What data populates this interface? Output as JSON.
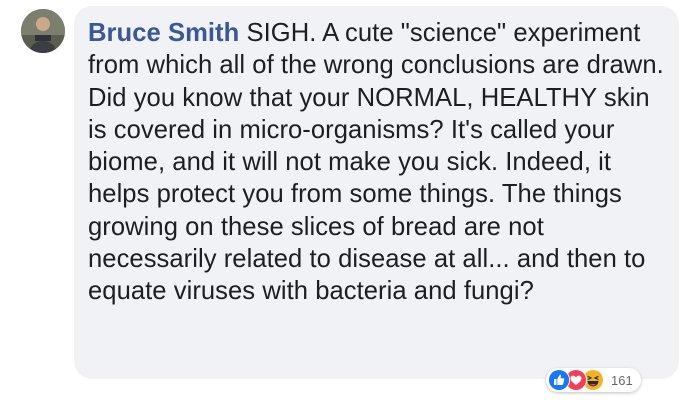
{
  "comment": {
    "author": "Bruce Smith",
    "text": "SIGH. A cute \"science\" experiment from which all of the wrong conclusions are drawn. Did you know that your NORMAL, HEALTHY skin is covered in micro-organisms? It's called your biome, and it will not make you sick. Indeed, it helps protect you from some things. The things growing on these slices of bread are not necessarily related to disease at all... and then to equate viruses with bacteria and fungi?"
  },
  "reactions": {
    "icons": [
      "like-icon",
      "love-icon",
      "haha-icon"
    ],
    "count": "161"
  },
  "colors": {
    "author": "#385898",
    "bubble": "#f0f2f5",
    "text": "#1c1e21",
    "like": "#1877f2",
    "love": "#f33e58",
    "haha": "#f7b125"
  }
}
